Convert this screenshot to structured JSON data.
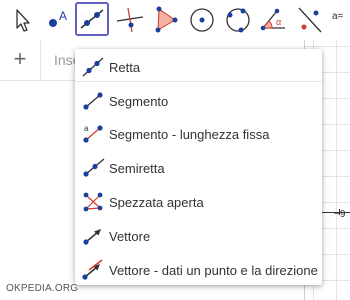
{
  "toolbar": {
    "tools": [
      {
        "icon": "pointer-arrow-icon"
      },
      {
        "icon": "point-A-icon",
        "letter": "A"
      },
      {
        "icon": "line-tool-icon",
        "active": true
      },
      {
        "icon": "perpendicular-line-icon"
      },
      {
        "icon": "polygon-icon"
      },
      {
        "icon": "circle-center-point-icon"
      },
      {
        "icon": "circle-through-3-points-icon"
      },
      {
        "icon": "angle-icon",
        "letter": "α"
      },
      {
        "icon": "reflect-about-line-icon"
      }
    ],
    "slider_label": "a="
  },
  "algebra": {
    "add_button": "+",
    "input_placeholder": "Inse"
  },
  "dropdown": {
    "items": [
      {
        "label": "Retta",
        "icon": "line-through-two-points-icon"
      },
      {
        "label": "Segmento",
        "icon": "segment-icon"
      },
      {
        "label": "Segmento - lunghezza fissa",
        "icon": "segment-fixed-length-icon"
      },
      {
        "label": "Semiretta",
        "icon": "ray-icon"
      },
      {
        "label": "Spezzata aperta",
        "icon": "polyline-icon"
      },
      {
        "label": "Vettore",
        "icon": "vector-icon"
      },
      {
        "label": "Vettore - dati un punto e la direzione",
        "icon": "vector-from-point-icon"
      }
    ]
  },
  "graphics": {
    "x_tick_label": "−9"
  },
  "watermark": "OKPEDIA.ORG",
  "colors": {
    "point_blue": "#1b3f9e",
    "active_border": "#5f5fc4",
    "polygon_fill": "#f5b0a0",
    "accent_red": "#d33b2a"
  }
}
